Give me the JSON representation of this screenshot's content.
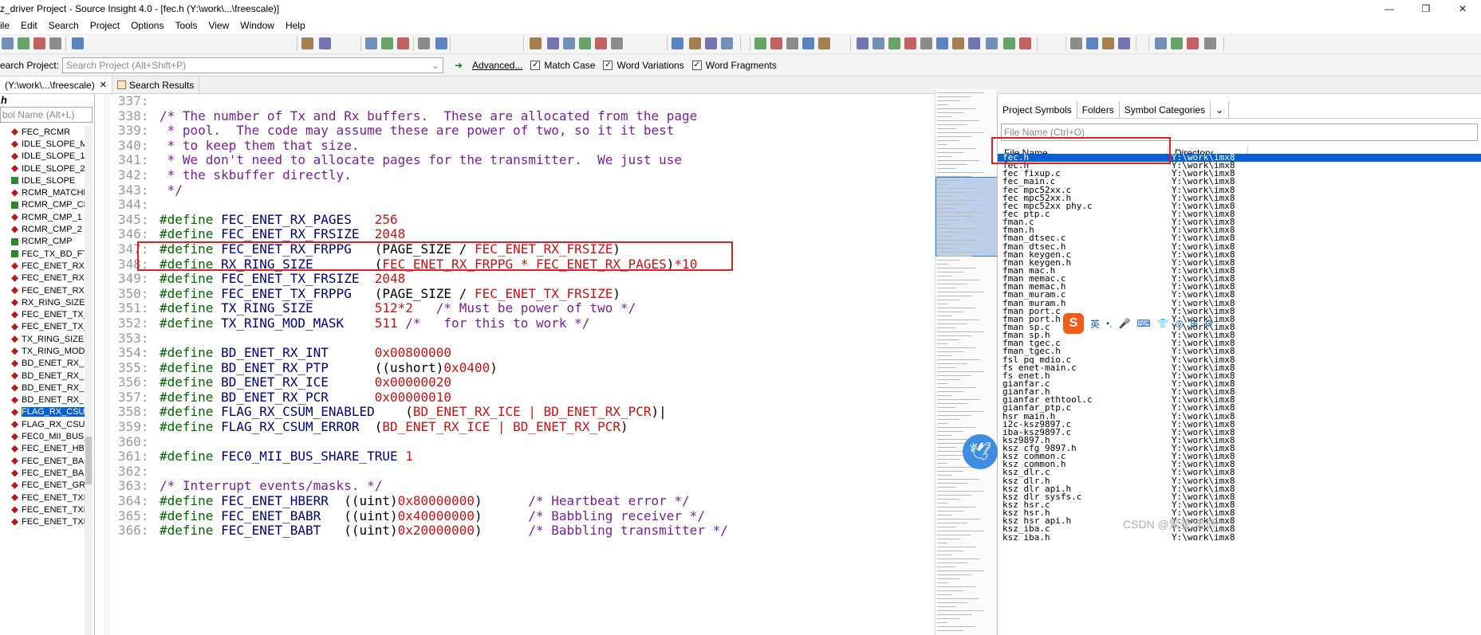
{
  "window": {
    "title": "z_driver Project - Source Insight 4.0 - [fec.h (Y:\\work\\...\\freescale)]",
    "controls": [
      "—",
      "❐",
      "✕"
    ]
  },
  "menu": [
    "ile",
    "Edit",
    "Search",
    "Project",
    "Options",
    "Tools",
    "View",
    "Window",
    "Help"
  ],
  "searchbar": {
    "label": "earch Project:",
    "placeholder": "Search Project (Alt+Shift+P)",
    "go": "➜",
    "advanced": "Advanced...",
    "checks": [
      {
        "label": "Match Case",
        "checked": true
      },
      {
        "label": "Word Variations",
        "checked": true
      },
      {
        "label": "Word Fragments",
        "checked": true
      }
    ]
  },
  "tabs": [
    {
      "label": "(Y:\\work\\...\\freescale)",
      "close": "✕",
      "active": true
    },
    {
      "label": "Search Results",
      "active": false
    }
  ],
  "left": {
    "header": "h",
    "search_placeholder": "bol Name (Alt+L)",
    "symbols": [
      {
        "name": "FEC_RCMR",
        "icon": "r"
      },
      {
        "name": "IDLE_SLOPE_MA",
        "icon": "r"
      },
      {
        "name": "IDLE_SLOPE_1",
        "icon": "r"
      },
      {
        "name": "IDLE_SLOPE_2",
        "icon": "r"
      },
      {
        "name": "IDLE_SLOPE",
        "icon": "g"
      },
      {
        "name": "RCMR_MATCHE",
        "icon": "r"
      },
      {
        "name": "RCMR_CMP_CF",
        "icon": "g"
      },
      {
        "name": "RCMR_CMP_1",
        "icon": "r"
      },
      {
        "name": "RCMR_CMP_2",
        "icon": "r"
      },
      {
        "name": "RCMR_CMP",
        "icon": "g"
      },
      {
        "name": "FEC_TX_BD_FTY",
        "icon": "g"
      },
      {
        "name": "FEC_ENET_RX_F",
        "icon": "r"
      },
      {
        "name": "FEC_ENET_RX_F",
        "icon": "r"
      },
      {
        "name": "FEC_ENET_RX_F",
        "icon": "r"
      },
      {
        "name": "RX_RING_SIZE",
        "icon": "r"
      },
      {
        "name": "FEC_ENET_TX_F",
        "icon": "r"
      },
      {
        "name": "FEC_ENET_TX_F",
        "icon": "r"
      },
      {
        "name": "TX_RING_SIZE",
        "icon": "r"
      },
      {
        "name": "TX_RING_MOD",
        "icon": "r"
      },
      {
        "name": "BD_ENET_RX_IN",
        "icon": "r"
      },
      {
        "name": "BD_ENET_RX_P",
        "icon": "r"
      },
      {
        "name": "BD_ENET_RX_IC",
        "icon": "r"
      },
      {
        "name": "BD_ENET_RX_P",
        "icon": "r"
      },
      {
        "name": "FLAG_RX_CSUM",
        "icon": "r",
        "selected": true
      },
      {
        "name": "FLAG_RX_CSUM",
        "icon": "r"
      },
      {
        "name": "FEC0_MII_BUS_",
        "icon": "r"
      },
      {
        "name": "FEC_ENET_HBE",
        "icon": "r"
      },
      {
        "name": "FEC_ENET_BAB",
        "icon": "r"
      },
      {
        "name": "FEC_ENET_BAB",
        "icon": "r"
      },
      {
        "name": "FEC_ENET_GRA",
        "icon": "r"
      },
      {
        "name": "FEC_ENET_TXF",
        "icon": "r"
      },
      {
        "name": "FEC_ENET_TXF",
        "icon": "r"
      },
      {
        "name": "FEC_ENET_TXB",
        "icon": "r"
      }
    ]
  },
  "code": [
    {
      "n": "337:",
      "parts": []
    },
    {
      "n": "338:",
      "parts": [
        [
          "cm",
          "/* The number of Tx and Rx buffers.  These are allocated from the page"
        ]
      ]
    },
    {
      "n": "339:",
      "parts": [
        [
          "cm",
          " * pool.  The code may assume these are power of two, so it it best"
        ]
      ]
    },
    {
      "n": "340:",
      "parts": [
        [
          "cm",
          " * to keep them that size."
        ]
      ]
    },
    {
      "n": "341:",
      "parts": [
        [
          "cm",
          " * We don't need to allocate pages for the transmitter.  We just use"
        ]
      ]
    },
    {
      "n": "342:",
      "parts": [
        [
          "cm",
          " * the skbuffer directly."
        ]
      ]
    },
    {
      "n": "343:",
      "parts": [
        [
          "cm",
          " */"
        ]
      ]
    },
    {
      "n": "344:",
      "parts": []
    },
    {
      "n": "345:",
      "parts": [
        [
          "kw",
          "#define "
        ],
        [
          "mac",
          "FEC_ENET_RX_PAGES   "
        ],
        [
          "num2",
          "256"
        ]
      ]
    },
    {
      "n": "346:",
      "parts": [
        [
          "kw",
          "#define "
        ],
        [
          "mac",
          "FEC_ENET_RX_FRSIZE  "
        ],
        [
          "num2",
          "2048"
        ]
      ]
    },
    {
      "n": "347:",
      "parts": [
        [
          "kw",
          "#define "
        ],
        [
          "mac",
          "FEC_ENET_RX_FRPPG   "
        ],
        [
          "",
          "(PAGE_SIZE / "
        ],
        [
          "red",
          "FEC_ENET_RX_FRSIZE"
        ],
        [
          "",
          ")"
        ]
      ]
    },
    {
      "n": "348:",
      "parts": [
        [
          "kw",
          "#define "
        ],
        [
          "mac",
          "RX_RING_SIZE        "
        ],
        [
          "",
          "("
        ],
        [
          "red",
          "FEC_ENET_RX_FRPPG * FEC_ENET_RX_PAGES"
        ],
        [
          "",
          ")"
        ],
        [
          "num2",
          "*10"
        ]
      ]
    },
    {
      "n": "349:",
      "parts": [
        [
          "kw",
          "#define "
        ],
        [
          "mac",
          "FEC_ENET_TX_FRSIZE  "
        ],
        [
          "num2",
          "2048"
        ]
      ]
    },
    {
      "n": "350:",
      "parts": [
        [
          "kw",
          "#define "
        ],
        [
          "mac",
          "FEC_ENET_TX_FRPPG   "
        ],
        [
          "",
          "(PAGE_SIZE / "
        ],
        [
          "red",
          "FEC_ENET_TX_FRSIZE"
        ],
        [
          "",
          ")"
        ]
      ]
    },
    {
      "n": "351:",
      "parts": [
        [
          "kw",
          "#define "
        ],
        [
          "mac",
          "TX_RING_SIZE        "
        ],
        [
          "num2",
          "512*2"
        ],
        [
          "cm",
          "   /* Must be power of two */"
        ]
      ]
    },
    {
      "n": "352:",
      "parts": [
        [
          "kw",
          "#define "
        ],
        [
          "mac",
          "TX_RING_MOD_MASK    "
        ],
        [
          "num2",
          "511"
        ],
        [
          "cm",
          " /*   for this to work */"
        ]
      ]
    },
    {
      "n": "353:",
      "parts": []
    },
    {
      "n": "354:",
      "parts": [
        [
          "kw",
          "#define "
        ],
        [
          "mac",
          "BD_ENET_RX_INT      "
        ],
        [
          "num2",
          "0x00800000"
        ]
      ]
    },
    {
      "n": "355:",
      "parts": [
        [
          "kw",
          "#define "
        ],
        [
          "mac",
          "BD_ENET_RX_PTP      "
        ],
        [
          "",
          "((ushort)"
        ],
        [
          "num2",
          "0x0400"
        ],
        [
          "",
          ")"
        ]
      ]
    },
    {
      "n": "356:",
      "parts": [
        [
          "kw",
          "#define "
        ],
        [
          "mac",
          "BD_ENET_RX_ICE      "
        ],
        [
          "num2",
          "0x00000020"
        ]
      ]
    },
    {
      "n": "357:",
      "parts": [
        [
          "kw",
          "#define "
        ],
        [
          "mac",
          "BD_ENET_RX_PCR      "
        ],
        [
          "num2",
          "0x00000010"
        ]
      ]
    },
    {
      "n": "358:",
      "parts": [
        [
          "kw",
          "#define "
        ],
        [
          "mac",
          "FLAG_RX_CSUM_ENABLED    "
        ],
        [
          "",
          "("
        ],
        [
          "red",
          "BD_ENET_RX_ICE | BD_ENET_RX_PCR"
        ],
        [
          "",
          ")|"
        ]
      ]
    },
    {
      "n": "359:",
      "parts": [
        [
          "kw",
          "#define "
        ],
        [
          "mac",
          "FLAG_RX_CSUM_ERROR  "
        ],
        [
          "",
          "("
        ],
        [
          "red",
          "BD_ENET_RX_ICE | BD_ENET_RX_PCR"
        ],
        [
          "",
          ")"
        ]
      ]
    },
    {
      "n": "360:",
      "parts": []
    },
    {
      "n": "361:",
      "parts": [
        [
          "kw",
          "#define "
        ],
        [
          "mac",
          "FEC0_MII_BUS_SHARE_TRUE "
        ],
        [
          "num2",
          "1"
        ]
      ]
    },
    {
      "n": "362:",
      "parts": []
    },
    {
      "n": "363:",
      "parts": [
        [
          "cm",
          "/* Interrupt events/masks. */"
        ]
      ]
    },
    {
      "n": "364:",
      "parts": [
        [
          "kw",
          "#define "
        ],
        [
          "mac",
          "FEC_ENET_HBERR  "
        ],
        [
          "",
          "((uint)"
        ],
        [
          "num2",
          "0x80000000"
        ],
        [
          "",
          ")      "
        ],
        [
          "cm",
          "/* Heartbeat error */"
        ]
      ]
    },
    {
      "n": "365:",
      "parts": [
        [
          "kw",
          "#define "
        ],
        [
          "mac",
          "FEC_ENET_BABR   "
        ],
        [
          "",
          "((uint)"
        ],
        [
          "num2",
          "0x40000000"
        ],
        [
          "",
          ")      "
        ],
        [
          "cm",
          "/* Babbling receiver */"
        ]
      ]
    },
    {
      "n": "366:",
      "parts": [
        [
          "kw",
          "#define "
        ],
        [
          "mac",
          "FEC_ENET_BABT   "
        ],
        [
          "",
          "((uint)"
        ],
        [
          "num2",
          "0x20000000"
        ],
        [
          "",
          ")      "
        ],
        [
          "cm",
          "/* Babbling transmitter */"
        ]
      ]
    }
  ],
  "right": {
    "tabs": [
      "Project Symbols",
      "Folders",
      "Symbol Categories",
      "⌄"
    ],
    "search_placeholder": "File Name (Ctrl+O)",
    "col_name": "File Name",
    "col_dir": "Directory",
    "files": [
      {
        "name": "fec.h",
        "dir": "Y:\\work\\imx8",
        "selected": true
      },
      {
        "name": "fec.h",
        "dir": "Y:\\work\\imx8"
      },
      {
        "name": "fec_fixup.c",
        "dir": "Y:\\work\\imx8"
      },
      {
        "name": "fec_main.c",
        "dir": "Y:\\work\\imx8"
      },
      {
        "name": "fec_mpc52xx.c",
        "dir": "Y:\\work\\imx8"
      },
      {
        "name": "fec_mpc52xx.h",
        "dir": "Y:\\work\\imx8"
      },
      {
        "name": "fec_mpc52xx_phy.c",
        "dir": "Y:\\work\\imx8"
      },
      {
        "name": "fec_ptp.c",
        "dir": "Y:\\work\\imx8"
      },
      {
        "name": "fman.c",
        "dir": "Y:\\work\\imx8"
      },
      {
        "name": "fman.h",
        "dir": "Y:\\work\\imx8"
      },
      {
        "name": "fman_dtsec.c",
        "dir": "Y:\\work\\imx8"
      },
      {
        "name": "fman_dtsec.h",
        "dir": "Y:\\work\\imx8"
      },
      {
        "name": "fman_keygen.c",
        "dir": "Y:\\work\\imx8"
      },
      {
        "name": "fman_keygen.h",
        "dir": "Y:\\work\\imx8"
      },
      {
        "name": "fman_mac.h",
        "dir": "Y:\\work\\imx8"
      },
      {
        "name": "fman_memac.c",
        "dir": "Y:\\work\\imx8"
      },
      {
        "name": "fman_memac.h",
        "dir": "Y:\\work\\imx8"
      },
      {
        "name": "fman_muram.c",
        "dir": "Y:\\work\\imx8"
      },
      {
        "name": "fman_muram.h",
        "dir": "Y:\\work\\imx8"
      },
      {
        "name": "fman_port.c",
        "dir": "Y:\\work\\imx8"
      },
      {
        "name": "fman_port.h",
        "dir": "Y:\\work\\imx8"
      },
      {
        "name": "fman_sp.c",
        "dir": "Y:\\work\\imx8"
      },
      {
        "name": "fman_sp.h",
        "dir": "Y:\\work\\imx8"
      },
      {
        "name": "fman_tgec.c",
        "dir": "Y:\\work\\imx8"
      },
      {
        "name": "fman_tgec.h",
        "dir": "Y:\\work\\imx8"
      },
      {
        "name": "fsl_pq_mdio.c",
        "dir": "Y:\\work\\imx8"
      },
      {
        "name": "fs_enet-main.c",
        "dir": "Y:\\work\\imx8"
      },
      {
        "name": "fs_enet.h",
        "dir": "Y:\\work\\imx8"
      },
      {
        "name": "gianfar.c",
        "dir": "Y:\\work\\imx8"
      },
      {
        "name": "gianfar.h",
        "dir": "Y:\\work\\imx8"
      },
      {
        "name": "gianfar_ethtool.c",
        "dir": "Y:\\work\\imx8"
      },
      {
        "name": "gianfar_ptp.c",
        "dir": "Y:\\work\\imx8"
      },
      {
        "name": "hsr_main.h",
        "dir": "Y:\\work\\imx8"
      },
      {
        "name": "i2c-ksz9897.c",
        "dir": "Y:\\work\\imx8"
      },
      {
        "name": "iba-ksz9897.c",
        "dir": "Y:\\work\\imx8"
      },
      {
        "name": "ksz9897.h",
        "dir": "Y:\\work\\imx8"
      },
      {
        "name": "ksz_cfg_9897.h",
        "dir": "Y:\\work\\imx8"
      },
      {
        "name": "ksz_common.c",
        "dir": "Y:\\work\\imx8"
      },
      {
        "name": "ksz_common.h",
        "dir": "Y:\\work\\imx8"
      },
      {
        "name": "ksz_dlr.c",
        "dir": "Y:\\work\\imx8"
      },
      {
        "name": "ksz_dlr.h",
        "dir": "Y:\\work\\imx8"
      },
      {
        "name": "ksz_dlr_api.h",
        "dir": "Y:\\work\\imx8"
      },
      {
        "name": "ksz_dlr_sysfs.c",
        "dir": "Y:\\work\\imx8"
      },
      {
        "name": "ksz_hsr.c",
        "dir": "Y:\\work\\imx8"
      },
      {
        "name": "ksz_hsr.h",
        "dir": "Y:\\work\\imx8"
      },
      {
        "name": "ksz_hsr_api.h",
        "dir": "Y:\\work\\imx8"
      },
      {
        "name": "ksz_iba.c",
        "dir": "Y:\\work\\imx8"
      },
      {
        "name": "ksz_iba.h",
        "dir": "Y:\\work\\imx8"
      }
    ]
  },
  "overlay": {
    "ime_logo": "S",
    "ime_items": [
      "英",
      "•,",
      "🎤",
      "⌨",
      "👕",
      "◎",
      "⊞",
      "⚙"
    ],
    "bird": "🕊",
    "watermark": "CSDN @繁星\"老师"
  },
  "colors": {
    "accent": "#0a5fd4",
    "highlight": "#e02020"
  }
}
